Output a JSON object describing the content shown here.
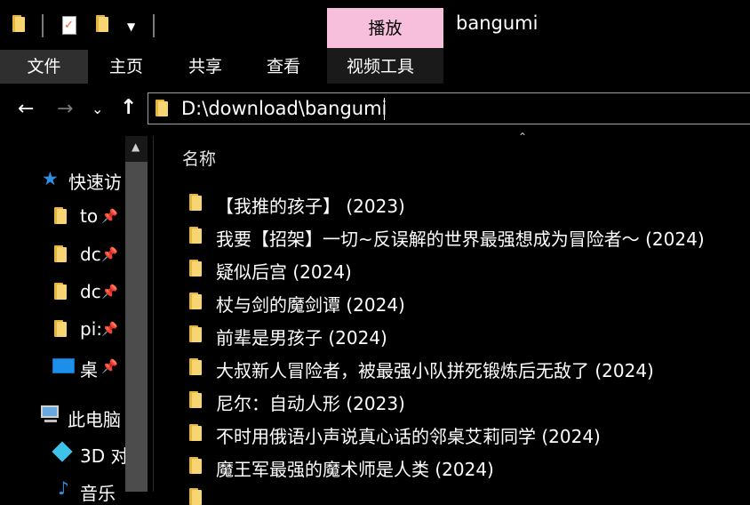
{
  "window": {
    "title": "bangumi"
  },
  "quick_access_toolbar": {
    "dropdown_icon": "chevron-down",
    "check_glyph": "✓"
  },
  "context_tab": {
    "label": "播放",
    "color": "#f8bfdc"
  },
  "ribbon": {
    "tabs": [
      {
        "label": "文件"
      },
      {
        "label": "主页"
      },
      {
        "label": "共享"
      },
      {
        "label": "查看"
      },
      {
        "label": "视频工具"
      }
    ]
  },
  "navigation": {
    "back_glyph": "←",
    "forward_glyph": "→",
    "recent_glyph": "⌄",
    "up_glyph": "↑"
  },
  "address": {
    "path": "D:\\download\\bangumi"
  },
  "nav_pane": {
    "quick_access": "快速访",
    "pin_glyph": "📌",
    "items": [
      {
        "label": "to"
      },
      {
        "label": "dc"
      },
      {
        "label": "dc"
      },
      {
        "label": "pi:"
      },
      {
        "label": "桌"
      }
    ],
    "this_pc": "此电脑",
    "pc_items": [
      {
        "label": "3D 对"
      },
      {
        "label": "音乐"
      }
    ],
    "scroll_up_glyph": "▲"
  },
  "content": {
    "column_name": "名称",
    "sort_glyph": "⌃",
    "files": [
      {
        "name": "【我推的孩子】 (2023)"
      },
      {
        "name": "我要【招架】一切~反误解的世界最强想成为冒险者～ (2024)"
      },
      {
        "name": "疑似后宫 (2024)"
      },
      {
        "name": "杖与剑的魔剑谭 (2024)"
      },
      {
        "name": "前辈是男孩子 (2024)"
      },
      {
        "name": "大叔新人冒险者，被最强小队拼死锻炼后无敌了 (2024)"
      },
      {
        "name": "尼尔：自动人形 (2023)"
      },
      {
        "name": "不时用俄语小声说真心话的邻桌艾莉同学 (2024)"
      },
      {
        "name": "魔王军最强的魔术师是人类 (2024)"
      }
    ]
  },
  "colors": {
    "folder": "#f7d572",
    "background": "#000000",
    "accent_star": "#2f8fe0"
  }
}
